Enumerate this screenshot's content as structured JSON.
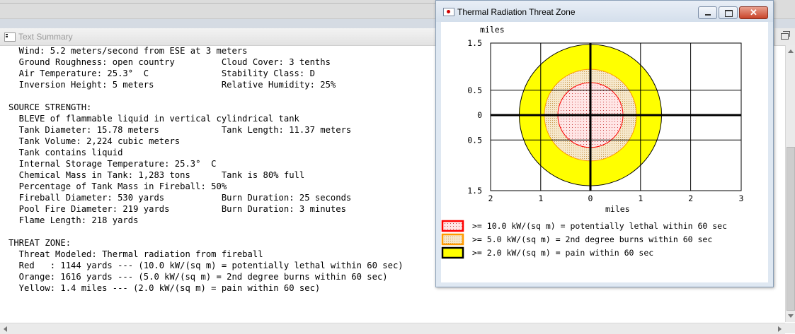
{
  "text_summary": {
    "title": "Text Summary",
    "lines": [
      "  Wind: 5.2 meters/second from ESE at 3 meters",
      "  Ground Roughness: open country         Cloud Cover: 3 tenths",
      "  Air Temperature: 25.3°  C              Stability Class: D",
      "  Inversion Height: 5 meters             Relative Humidity: 25%",
      "",
      "SOURCE STRENGTH:",
      "  BLEVE of flammable liquid in vertical cylindrical tank",
      "  Tank Diameter: 15.78 meters            Tank Length: 11.37 meters",
      "  Tank Volume: 2,224 cubic meters",
      "  Tank contains liquid",
      "  Internal Storage Temperature: 25.3°  C",
      "  Chemical Mass in Tank: 1,283 tons      Tank is 80% full",
      "  Percentage of Tank Mass in Fireball: 50%",
      "  Fireball Diameter: 530 yards           Burn Duration: 25 seconds",
      "  Pool Fire Diameter: 219 yards          Burn Duration: 3 minutes",
      "  Flame Length: 218 yards",
      "",
      "THREAT ZONE:",
      "  Threat Modeled: Thermal radiation from fireball",
      "  Red   : 1144 yards --- (10.0 kW/(sq m) = potentially lethal within 60 sec)",
      "  Orange: 1616 yards --- (5.0 kW/(sq m) = 2nd degree burns within 60 sec)",
      "  Yellow: 1.4 miles --- (2.0 kW/(sq m) = pain within 60 sec)"
    ]
  },
  "threat_zone": {
    "title": "Thermal Radiation Threat Zone",
    "close_glyph": "✕",
    "y_unit": "miles",
    "x_unit": "miles",
    "y_tick_labels": [
      "1.5",
      "0.5",
      "0",
      "0.5",
      "1.5"
    ],
    "x_tick_labels": [
      "2",
      "1",
      "0",
      "1",
      "2",
      "3"
    ],
    "zones": [
      {
        "name": "red",
        "radius_miles": 0.65,
        "fill": "#ffdede",
        "stroke": "#ff0000",
        "legend_border": "#ff0000",
        "legend": ">= 10.0 kW/(sq m) = potentially lethal within 60 sec"
      },
      {
        "name": "orange",
        "radius_miles": 0.92,
        "fill": "#f5e2c0",
        "stroke": "#ff9a00",
        "legend_border": "#ff9a00",
        "legend": ">= 5.0 kW/(sq m) = 2nd degree burns within 60 sec"
      },
      {
        "name": "yellow",
        "radius_miles": 1.42,
        "fill": "#ffff00",
        "stroke": "#000000",
        "legend_border": "#000000",
        "legend": ">= 2.0 kW/(sq m) = pain within 60 sec"
      }
    ]
  }
}
